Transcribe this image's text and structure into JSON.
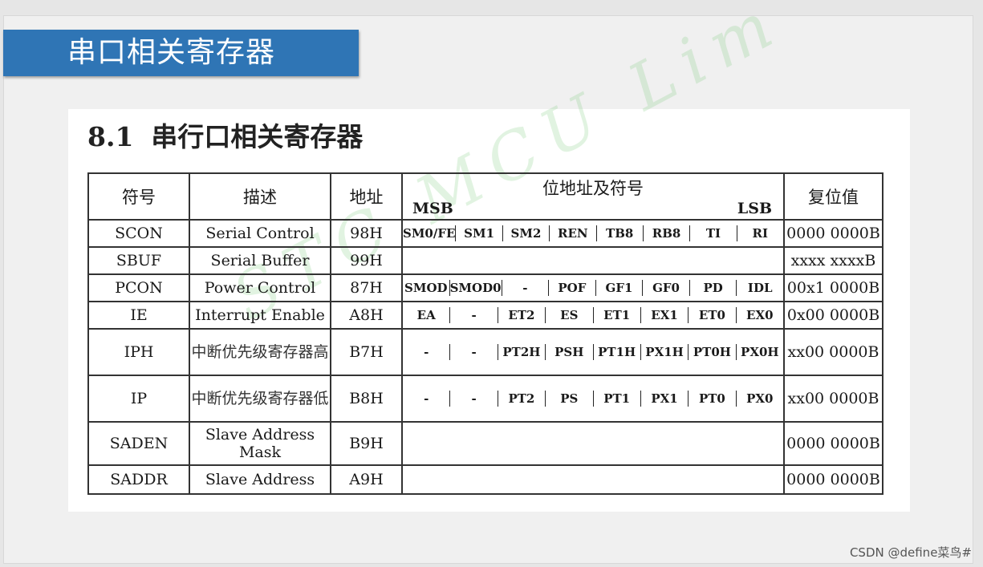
{
  "slide": {
    "banner_title": "串口相关寄存器"
  },
  "doc": {
    "heading_num": "8.1",
    "heading_text": "串行口相关寄存器",
    "watermark": "STC MCU Lim"
  },
  "table": {
    "headers": {
      "symbol": "符号",
      "desc": "描述",
      "addr": "地址",
      "bits_title": "位地址及符号",
      "msb": "MSB",
      "lsb": "LSB",
      "reset": "复位值"
    },
    "rows": [
      {
        "symbol": "SCON",
        "desc": "Serial Control",
        "addr": "98H",
        "bits": [
          "SM0/FE",
          "SM1",
          "SM2",
          "REN",
          "TB8",
          "RB8",
          "TI",
          "RI"
        ],
        "reset": "0000 0000B"
      },
      {
        "symbol": "SBUF",
        "desc": "Serial Buffer",
        "addr": "99H",
        "bits": [],
        "reset": "xxxx xxxxB"
      },
      {
        "symbol": "PCON",
        "desc": "Power Control",
        "addr": "87H",
        "bits": [
          "SMOD",
          "SMOD0",
          "-",
          "POF",
          "GF1",
          "GF0",
          "PD",
          "IDL"
        ],
        "reset": "00x1 0000B"
      },
      {
        "symbol": "IE",
        "desc": "Interrupt Enable",
        "addr": "A8H",
        "bits": [
          "EA",
          "-",
          "ET2",
          "ES",
          "ET1",
          "EX1",
          "ET0",
          "EX0"
        ],
        "reset": "0x00 0000B"
      },
      {
        "symbol": "IPH",
        "desc": "中断优先级寄存器高",
        "addr": "B7H",
        "bits": [
          "-",
          "-",
          "PT2H",
          "PSH",
          "PT1H",
          "PX1H",
          "PT0H",
          "PX0H"
        ],
        "reset": "xx00 0000B"
      },
      {
        "symbol": "IP",
        "desc": "中断优先级寄存器低",
        "addr": "B8H",
        "bits": [
          "-",
          "-",
          "PT2",
          "PS",
          "PT1",
          "PX1",
          "PT0",
          "PX0"
        ],
        "reset": "xx00 0000B"
      },
      {
        "symbol": "SADEN",
        "desc": "Slave Address Mask",
        "addr": "B9H",
        "bits": [],
        "reset": "0000 0000B"
      },
      {
        "symbol": "SADDR",
        "desc": "Slave Address",
        "addr": "A9H",
        "bits": [],
        "reset": "0000 0000B"
      }
    ]
  },
  "footer": {
    "credit": "CSDN @define菜鸟#"
  }
}
